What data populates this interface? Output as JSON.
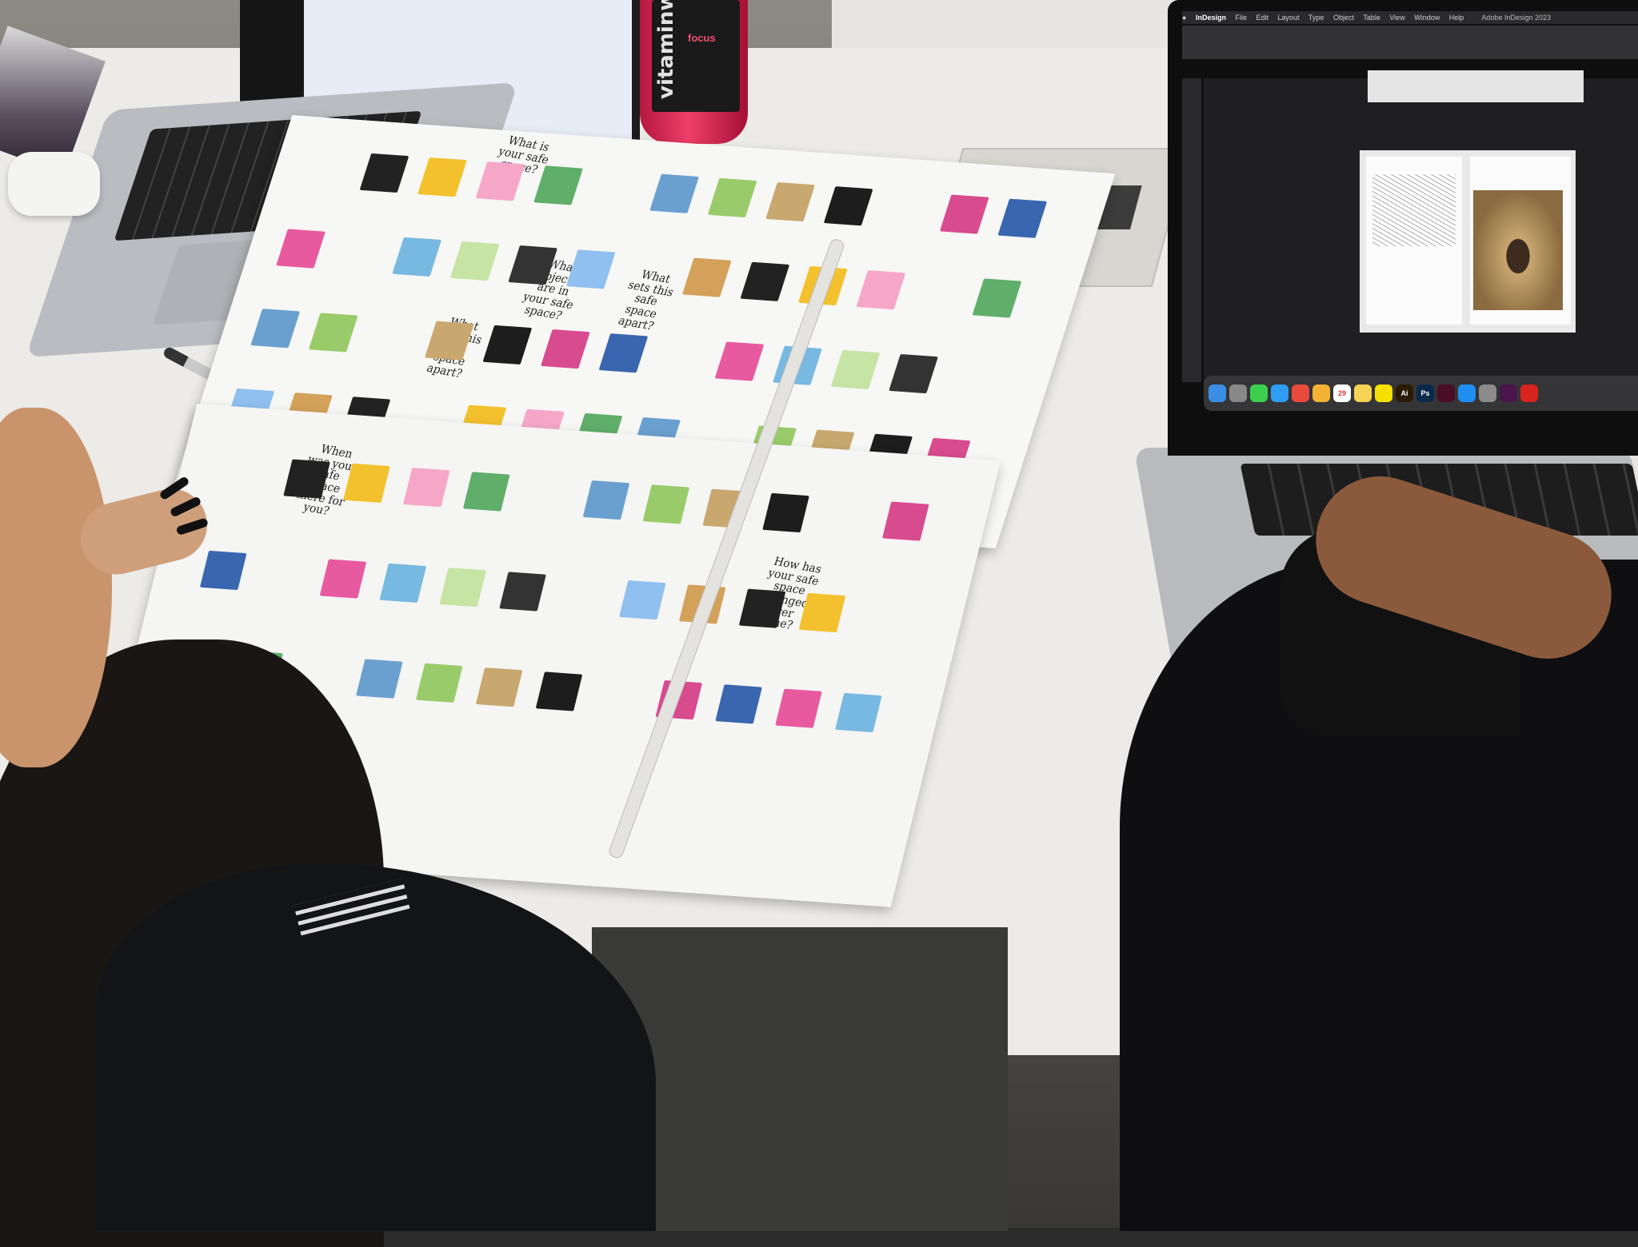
{
  "photo": {
    "scene": "Two people reviewing printed zine page layouts on a table with laptops"
  },
  "bottle": {
    "brand": "vitaminwater",
    "flavor": "focus"
  },
  "zine_questions": {
    "q1": "What is your safe space?",
    "q2": "What objects are in your safe space?",
    "q3": "What sets this safe space apart?",
    "q4": "What sets this safe space apart?",
    "q5": "When was your safe space there for you?",
    "q6": "How has your safe space changed over time?"
  },
  "indesign": {
    "app_name": "InDesign",
    "menu": [
      "File",
      "Edit",
      "Layout",
      "Type",
      "Object",
      "Table",
      "View",
      "Window",
      "Help"
    ],
    "window_title": "Adobe InDesign 2023"
  },
  "dock": {
    "icons": [
      {
        "name": "finder-icon",
        "color": "#3a8ee6",
        "label": ""
      },
      {
        "name": "launchpad-icon",
        "color": "#888888",
        "label": ""
      },
      {
        "name": "messages-icon",
        "color": "#3ccf4e",
        "label": ""
      },
      {
        "name": "safari-icon",
        "color": "#2f9df4",
        "label": ""
      },
      {
        "name": "chrome-icon",
        "color": "#e84a3c",
        "label": ""
      },
      {
        "name": "photos-icon",
        "color": "#f2b233",
        "label": ""
      },
      {
        "name": "calendar-icon",
        "color": "#ffffff",
        "label": "29"
      },
      {
        "name": "notes-icon",
        "color": "#f6d255",
        "label": ""
      },
      {
        "name": "kakaotalk-icon",
        "color": "#f6e000",
        "label": ""
      },
      {
        "name": "illustrator-icon",
        "color": "#2b1a05",
        "label": "Ai"
      },
      {
        "name": "photoshop-icon",
        "color": "#0a2a4a",
        "label": "Ps"
      },
      {
        "name": "indesign-icon",
        "color": "#4a0d23",
        "label": ""
      },
      {
        "name": "appstore-icon",
        "color": "#1e8ef0",
        "label": ""
      },
      {
        "name": "settings-icon",
        "color": "#8b8b8b",
        "label": ""
      },
      {
        "name": "slack-icon",
        "color": "#4a154b",
        "label": ""
      },
      {
        "name": "acrobat-icon",
        "color": "#d7241c",
        "label": ""
      }
    ]
  },
  "thumb_colors": [
    "#222222",
    "#f3c12d",
    "#f6a7c8",
    "#5fae6a",
    "#6aa0cf",
    "#9acb6a",
    "#c8a86e",
    "#1d1d1d",
    "#d84b8f",
    "#3a66b0",
    "#e85aa0",
    "#77b9e0",
    "#c6e4a3",
    "#333333",
    "#8fc0ef",
    "#d3a15a"
  ]
}
